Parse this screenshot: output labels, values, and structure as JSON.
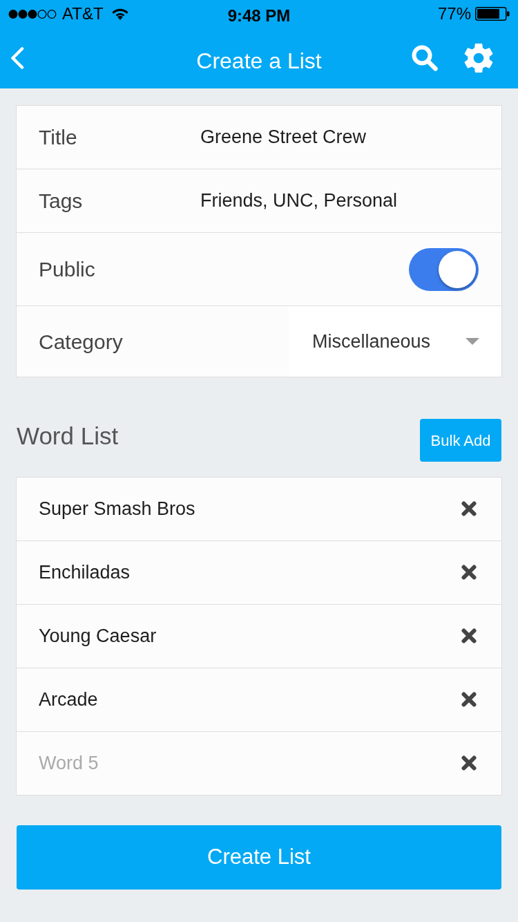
{
  "status_bar": {
    "carrier": "AT&T",
    "time": "9:48 PM",
    "battery": "77%"
  },
  "nav": {
    "title": "Create a List"
  },
  "form": {
    "fields": [
      {
        "kind": "text",
        "label": "Title",
        "value": "Greene Street Crew"
      },
      {
        "kind": "text",
        "label": "Tags",
        "value": "Friends, UNC, Personal"
      },
      {
        "kind": "toggle",
        "label": "Public",
        "on": true
      },
      {
        "kind": "select",
        "label": "Category",
        "value": "Miscellaneous"
      }
    ]
  },
  "word_list": {
    "heading": "Word List",
    "bulk_add": "Bulk Add",
    "words": [
      {
        "value": "Super Smash Bros"
      },
      {
        "value": "Enchiladas"
      },
      {
        "value": "Young Caesar"
      },
      {
        "value": "Arcade"
      },
      {
        "placeholder": "Word 5"
      }
    ]
  },
  "create_button": "Create List"
}
